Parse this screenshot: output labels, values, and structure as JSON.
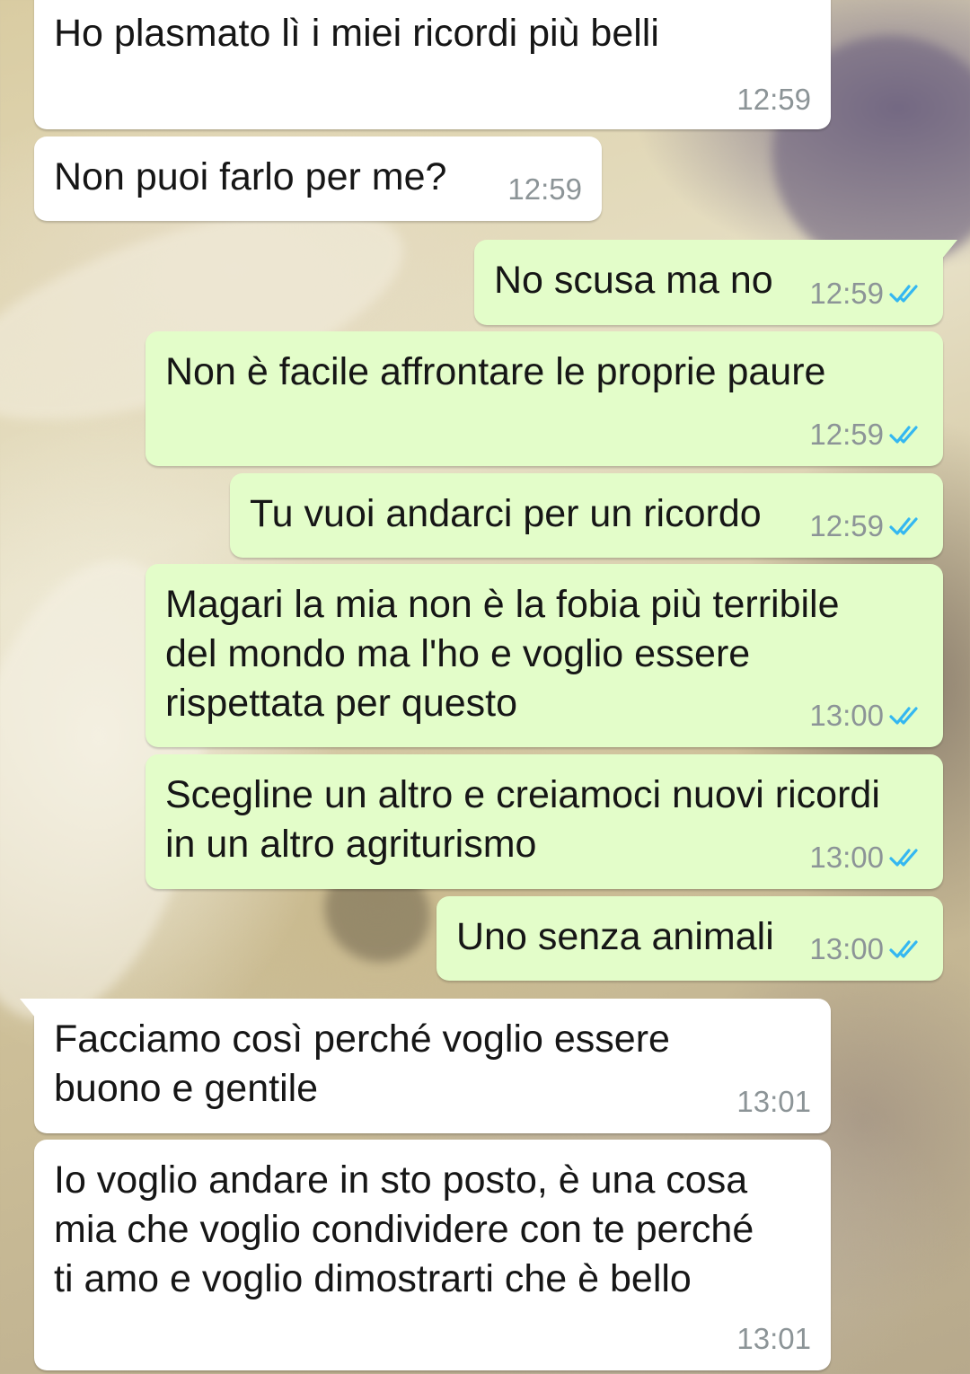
{
  "chat": {
    "messages": [
      {
        "direction": "in",
        "text": "Ho plasmato lì i miei ricordi più belli",
        "time": "12:59"
      },
      {
        "direction": "in",
        "text": "Non puoi farlo per me?",
        "time": "12:59"
      },
      {
        "direction": "out",
        "text": "No scusa ma no",
        "time": "12:59",
        "status": "read"
      },
      {
        "direction": "out",
        "text": "Non è facile affrontare le proprie paure",
        "time": "12:59",
        "status": "read"
      },
      {
        "direction": "out",
        "text": "Tu vuoi andarci per un ricordo",
        "time": "12:59",
        "status": "read"
      },
      {
        "direction": "out",
        "text": "Magari la mia non è la fobia più terribile\ndel mondo ma l'ho e voglio essere\nrispettata per questo",
        "time": "13:00",
        "status": "read"
      },
      {
        "direction": "out",
        "text": "Scegline un altro e creiamoci nuovi ricordi\nin un altro agriturismo",
        "time": "13:00",
        "status": "read"
      },
      {
        "direction": "out",
        "text": "Uno senza animali",
        "time": "13:00",
        "status": "read"
      },
      {
        "direction": "in",
        "text": "Facciamo così perché voglio essere\nbuono e gentile",
        "time": "13:01"
      },
      {
        "direction": "in",
        "text": "Io voglio andare in sto posto, è una cosa\nmia che voglio condividere con te perché\nti amo e voglio dimostrarti che è bello",
        "time": "13:01"
      }
    ]
  },
  "colors": {
    "incoming_bubble": "#ffffff",
    "outgoing_bubble": "#e3fdc9",
    "timestamp": "#8c9497",
    "read_ticks": "#34b7f1",
    "wallpaper": "photo (blurred pasta)"
  },
  "icons": {
    "read_receipt": "double-check-icon"
  }
}
